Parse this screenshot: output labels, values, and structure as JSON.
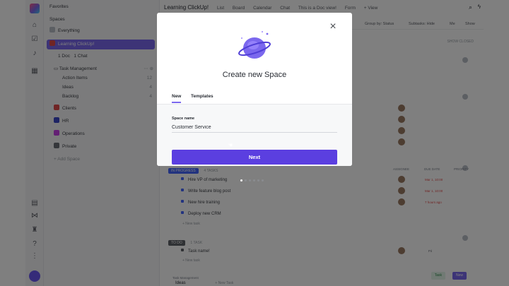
{
  "sidebar": {
    "favorites_label": "Favorites",
    "spaces_label": "Spaces",
    "everything_label": "Everything",
    "active_space": "Learning ClickUp!",
    "docs_label": "1 Doc",
    "chats_label": "1 Chat",
    "folder_label": "Task Management",
    "lists": [
      {
        "label": "Action Items",
        "count": "12"
      },
      {
        "label": "Ideas",
        "count": "4"
      },
      {
        "label": "Backlog",
        "count": "4"
      }
    ],
    "spaces": [
      "Clients",
      "HR",
      "Operations",
      "Private"
    ],
    "space_colors": [
      "#e14b4b",
      "#3b47c9",
      "#c840e9",
      "#6b6f76"
    ],
    "add_space_label": "Add Space"
  },
  "header": {
    "title": "Learning ClickUp!",
    "tabs": [
      "List",
      "Board",
      "Calendar",
      "Chat",
      "This is a Doc view!",
      "Form"
    ],
    "add_view": "+ View"
  },
  "toolbar": {
    "group_by": "Group by: Status",
    "subtasks": "Subtasks: Hide",
    "me": "Me",
    "show": "Show",
    "closed": "SHOW CLOSED"
  },
  "columns": {
    "assignee": "ASSIGNEE",
    "due": "DUE DATE",
    "priority": "PRIORITY"
  },
  "groups": [
    {
      "status": "IN PROGRESS",
      "count": "4 TASKS",
      "color": "#4466ff",
      "tasks": [
        "Hire VP of marketing",
        "Write feature blog post",
        "New hire training",
        "Deploy new CRM"
      ],
      "dues": [
        "Mar 1, 10:00",
        "Mar 1, 10:00",
        "7 hours ago",
        ""
      ]
    },
    {
      "status": "TO DO",
      "count": "1 TASK",
      "color": "#5f6368",
      "tasks": [
        "Task name!"
      ],
      "dues": [
        "Fri"
      ]
    }
  ],
  "new_task_label": "+ New task",
  "bottom_list": {
    "breadcrumb": "Task Management",
    "title": "Ideas",
    "new_task": "+ New Task"
  },
  "fabs": {
    "task": "Task",
    "new": "New"
  },
  "modal": {
    "title": "Create new Space",
    "tabs": [
      "New",
      "Templates"
    ],
    "active_tab": "New",
    "field_label": "Space name",
    "field_value": "Customer Service",
    "next_label": "Next",
    "close_symbol": "×",
    "pager_count": 6,
    "pager_active": 1
  },
  "colors": {
    "accent": "#7b68ee",
    "button": "#5b3fe0",
    "overlay": "rgba(0,0,0,0.5)"
  }
}
